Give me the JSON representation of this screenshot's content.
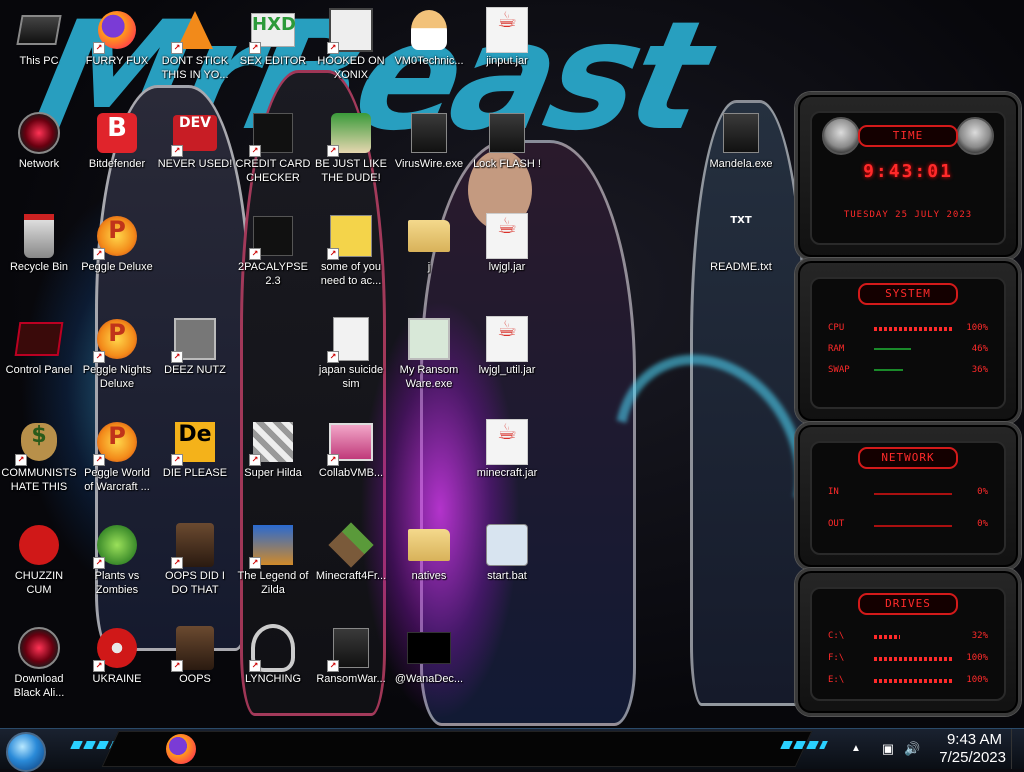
{
  "wallpaper": {
    "title_text": "MrBeast",
    "accent_color": "#2aa7c9"
  },
  "desktop_icons": [
    {
      "label": "This PC",
      "icon": "computer-icon"
    },
    {
      "label": "FURRY FUX",
      "icon": "firefox-icon"
    },
    {
      "label": "DONT STICK THIS IN YO...",
      "icon": "vlc-cone-icon"
    },
    {
      "label": "SEX EDITOR",
      "icon": "hxd-icon",
      "glyph": "HXD"
    },
    {
      "label": "HOOKED ON XONIX",
      "icon": "xonix-icon"
    },
    {
      "label": "VM0Technic...",
      "icon": "doctor-icon"
    },
    {
      "label": "jinput.jar",
      "icon": "java-jar-icon",
      "glyph": "☕"
    },
    {
      "label": "Network",
      "icon": "alienware-icon"
    },
    {
      "label": "Bitdefender",
      "icon": "bitdefender-icon",
      "glyph": "B"
    },
    {
      "label": "NEVER USED!",
      "icon": "dev-cpp-icon",
      "glyph": "DEV"
    },
    {
      "label": "CREDIT CARD CHECKER",
      "icon": "dark-app-icon"
    },
    {
      "label": "BE JUST LIKE THE DUDE!",
      "icon": "elf-icon"
    },
    {
      "label": "VirusWire.exe",
      "icon": "exe-icon"
    },
    {
      "label": "Lock FLASH !",
      "icon": "exe-icon"
    },
    {
      "label": "Mandela.exe",
      "icon": "exe-icon"
    },
    {
      "label": "Recycle Bin",
      "icon": "recycle-bin-icon"
    },
    {
      "label": "Peggle Deluxe",
      "icon": "peggle-icon",
      "glyph": "P"
    },
    {
      "label": "2PACALYPSE 2.3",
      "icon": "dark-app-icon"
    },
    {
      "label": "some of you need to ac...",
      "icon": "beaver-icon"
    },
    {
      "label": "j",
      "icon": "folder-icon"
    },
    {
      "label": "lwjgl.jar",
      "icon": "java-jar-icon",
      "glyph": "☕"
    },
    {
      "label": "README.txt",
      "icon": "text-file-icon",
      "glyph": "TXT"
    },
    {
      "label": "Control Panel",
      "icon": "control-panel-icon"
    },
    {
      "label": "Peggle Nights Deluxe",
      "icon": "peggle-icon",
      "glyph": "P"
    },
    {
      "label": "DEEZ NUTZ",
      "icon": "window-stack-icon"
    },
    {
      "label": "japan suicide sim",
      "icon": "document-icon"
    },
    {
      "label": "My Ransom Ware.exe",
      "icon": "app-window-icon"
    },
    {
      "label": "lwjgl_util.jar",
      "icon": "java-jar-icon",
      "glyph": "☕"
    },
    {
      "label": "COMMUNISTS HATE THIS G...",
      "icon": "money-bag-icon",
      "glyph": "$"
    },
    {
      "label": "Peggle World of Warcraft ...",
      "icon": "peggle-icon",
      "glyph": "P"
    },
    {
      "label": "DIE PLEASE",
      "icon": "de-icon",
      "glyph": "De"
    },
    {
      "label": "Super Hilda",
      "icon": "pixel-art-icon"
    },
    {
      "label": "CollabVMB...",
      "icon": "vm-monitor-icon"
    },
    {
      "label": "minecraft.jar",
      "icon": "java-jar-icon",
      "glyph": "☕"
    },
    {
      "label": "CHUZZIN CUM",
      "icon": "chuzzle-icon"
    },
    {
      "label": "Plants vs Zombies",
      "icon": "plant-icon"
    },
    {
      "label": "OOPS DID I DO THAT",
      "icon": "portrait-icon"
    },
    {
      "label": "The Legend of Zilda",
      "icon": "zelda-icon"
    },
    {
      "label": "Minecraft4Fr...",
      "icon": "grass-block-icon"
    },
    {
      "label": "natives",
      "icon": "folder-icon"
    },
    {
      "label": "start.bat",
      "icon": "batch-gear-icon"
    },
    {
      "label": "Download Black Ali...",
      "icon": "alienware-icon"
    },
    {
      "label": "UKRAINE",
      "icon": "radiation-icon"
    },
    {
      "label": "OOPS",
      "icon": "portrait-icon"
    },
    {
      "label": "LYNCHING",
      "icon": "knot-icon"
    },
    {
      "label": "RansomWar...",
      "icon": "exe-icon"
    },
    {
      "label": "@WanaDec...",
      "icon": "black-window-icon"
    }
  ],
  "gadgets": {
    "time": {
      "title": "TIME",
      "clock": "9:43:01",
      "date": "TUESDAY 25 JULY 2023"
    },
    "system": {
      "title": "SYSTEM",
      "rows": [
        {
          "key": "CPU",
          "value": "100%",
          "level": 1.0
        },
        {
          "key": "RAM",
          "value": "46%",
          "level": 0.46
        },
        {
          "key": "SWAP",
          "value": "36%",
          "level": 0.36
        }
      ]
    },
    "network": {
      "title": "NETWORK",
      "rows": [
        {
          "key": "IN",
          "value": "0%"
        },
        {
          "key": "OUT",
          "value": "0%"
        }
      ]
    },
    "drives": {
      "title": "DRIVES",
      "rows": [
        {
          "key": "C:\\",
          "value": "32%",
          "level": 0.32
        },
        {
          "key": "F:\\",
          "value": "100%",
          "level": 1.0
        },
        {
          "key": "E:\\",
          "value": "100%",
          "level": 1.0
        }
      ]
    },
    "accent_color": "#ff2a2a"
  },
  "taskbar": {
    "pinned": [
      {
        "name": "firefox-icon"
      }
    ],
    "tray": {
      "time": "9:43 AM",
      "date": "7/25/2023"
    }
  }
}
